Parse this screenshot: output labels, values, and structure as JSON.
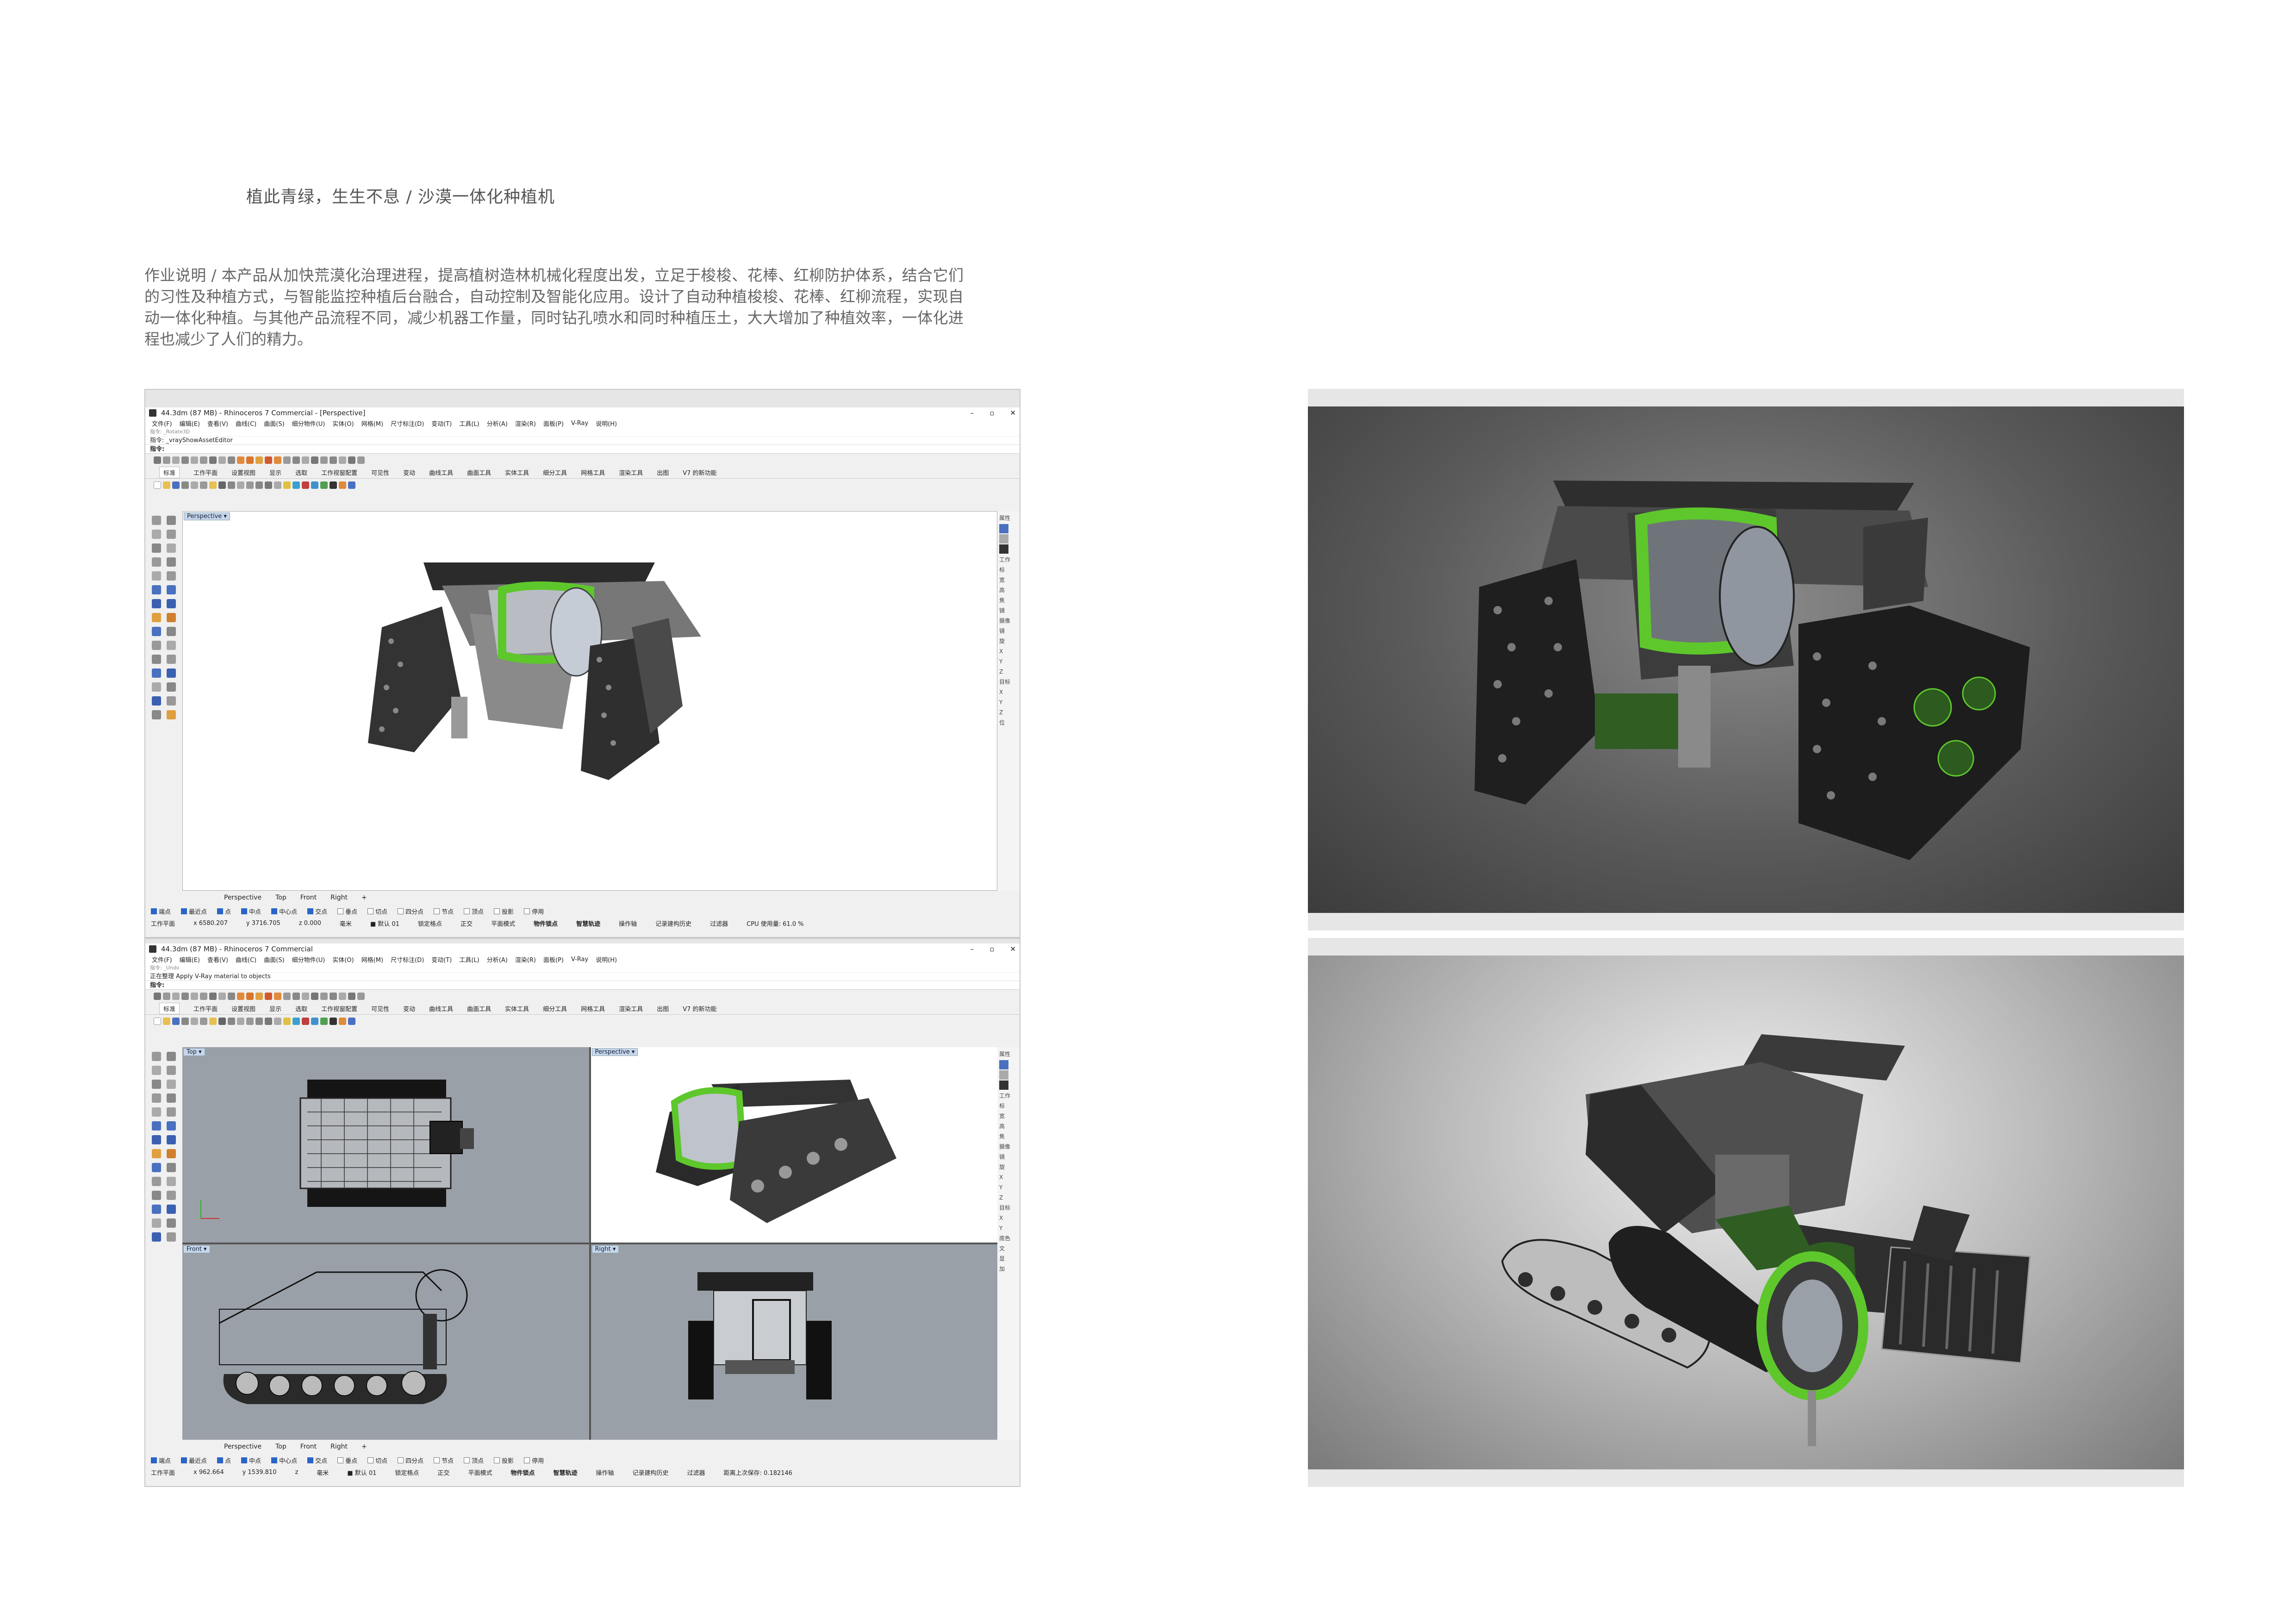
{
  "page_title": "植此青绿，生生不息 / 沙漠一体化种植机",
  "description": "作业说明  / 本产品从加快荒漠化治理进程，提高植树造林机械化程度出发，立足于梭梭、花棒、红柳防护体系，结合它们的习性及种植方式，与智能监控种植后台融合，自动控制及智能化应用。设计了自动种植梭梭、花棒、红柳流程，实现自动一体化种植。与其他产品流程不同，减少机器工作量，同时钻孔喷水和同时种植压土，大大增加了种植效率，一体化进程也减少了人们的精力。",
  "rhino": {
    "menu": [
      "文件(F)",
      "编辑(E)",
      "查看(V)",
      "曲线(C)",
      "曲面(S)",
      "细分物件(U)",
      "实体(O)",
      "网格(M)",
      "尺寸标注(D)",
      "变动(T)",
      "工具(L)",
      "分析(A)",
      "渲染(R)",
      "面板(P)",
      "V-Ray",
      "说明(H)"
    ],
    "tool_tabs": [
      "标准",
      "工作平面",
      "设置视图",
      "显示",
      "选取",
      "工作视窗配置",
      "可见性",
      "变动",
      "曲线工具",
      "曲面工具",
      "实体工具",
      "细分工具",
      "网格工具",
      "渲染工具",
      "出图",
      "V7 的新功能"
    ],
    "viewport_tabs": [
      "Perspective",
      "Top",
      "Front",
      "Right",
      "+"
    ],
    "osnaps": [
      {
        "label": "端点",
        "on": true
      },
      {
        "label": "最近点",
        "on": true
      },
      {
        "label": "点",
        "on": true
      },
      {
        "label": "中点",
        "on": true
      },
      {
        "label": "中心点",
        "on": true
      },
      {
        "label": "交点",
        "on": true
      },
      {
        "label": "垂点",
        "on": false
      },
      {
        "label": "切点",
        "on": false
      },
      {
        "label": "四分点",
        "on": false
      },
      {
        "label": "节点",
        "on": false
      },
      {
        "label": "顶点",
        "on": false
      },
      {
        "label": "投影",
        "on": false
      },
      {
        "label": "停用",
        "on": false
      }
    ],
    "right_panel": [
      "属性",
      "工作",
      "标",
      "宽",
      "高",
      "焦",
      "镜",
      "摄像",
      "镜",
      "旋",
      "X",
      "Y",
      "Z",
      "目标",
      "X",
      "Y",
      "Z",
      "位",
      "底色",
      "文",
      "显",
      "加"
    ],
    "window1": {
      "title": "44.3dm (87 MB) - Rhinoceros 7 Commercial - [Perspective]",
      "history": "指令: _Rotate3D",
      "history2": "指令: _vrayShowAssetEditor",
      "prompt": "指令:",
      "viewport_label": "Perspective ▾",
      "status": {
        "cplane": "工作平面",
        "x": "x 6580.207",
        "y": "y 3716.705",
        "z": "z 0.000",
        "unit": "毫米",
        "layer": "■ 默认 01",
        "toggles": [
          "锁定格点",
          "正交",
          "平面模式"
        ],
        "bold": [
          "物件锁点",
          "智慧轨迹"
        ],
        "rest": [
          "操作轴",
          "记录建构历史",
          "过滤器"
        ],
        "cpu": "CPU 使用量: 61.0 %"
      }
    },
    "window2": {
      "title": "44.3dm (87 MB) - Rhinoceros 7 Commercial",
      "history": "指令: _Undo",
      "history2": "正在整理 Apply V-Ray material to objects",
      "prompt": "指令:",
      "viewport_labels": [
        "Top ▾",
        "Perspective ▾",
        "Front ▾",
        "Right ▾"
      ],
      "status": {
        "cplane": "工作平面",
        "x": "x 962.664",
        "y": "y 1539.810",
        "z": "z",
        "unit": "毫米",
        "layer": "■ 默认 01",
        "toggles": [
          "锁定格点",
          "正交",
          "平面模式"
        ],
        "bold": [
          "物件锁点",
          "智慧轨迹"
        ],
        "rest": [
          "操作轴",
          "记录建构历史",
          "过滤器"
        ],
        "cpu": "距离上次保存: 0.182146"
      }
    }
  },
  "colors": {
    "accent_green": "#6bcf3c",
    "body_gray": "#6c6c6c",
    "track_black": "#1f1f1f",
    "render_bg": "#4a4a4a"
  }
}
